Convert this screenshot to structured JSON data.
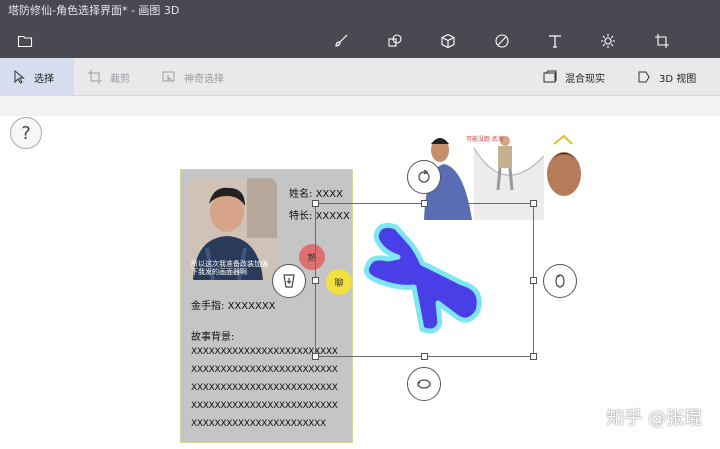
{
  "window": {
    "title": "塔防修仙-角色选择界面* - 画图 3D"
  },
  "toolbar": {
    "tools": [
      {
        "name": "folder-icon"
      },
      {
        "name": "brush-icon"
      },
      {
        "name": "2d-shapes-icon"
      },
      {
        "name": "3d-shapes-icon"
      },
      {
        "name": "stickers-icon"
      },
      {
        "name": "text-icon"
      },
      {
        "name": "effects-icon"
      },
      {
        "name": "canvas-icon"
      }
    ]
  },
  "subbar": {
    "select": "选择",
    "crop": "裁剪",
    "magic_select": "神奇选择",
    "mixed_reality": "混合现实",
    "view3d": "3D 视图"
  },
  "help": {
    "label": "?"
  },
  "card": {
    "name_label": "姓名:",
    "name_value": "XXXX",
    "trait_label": "特长:",
    "trait_value": "XXXXX",
    "cheat_label": "金手指:",
    "cheat_value": "XXXXXXX",
    "story_label": "故事背景:",
    "story_lines": [
      "XXXXXXXXXXXXXXXXXXXXXXXXX",
      "XXXXXXXXXXXXXXXXXXXXXXXXX",
      "XXXXXXXXXXXXXXXXXXXXXXXXX",
      "XXXXXXXXXXXXXXXXXXXXXXXXX",
      "XXXXXXXXXXXXXXXXXXXXXXX"
    ],
    "photo_caption": "所以这次我准备改装加强下我发的画面器啊",
    "bubble_red": "熟",
    "bubble_yellow": "聊"
  },
  "sticker": {
    "caption": "可能没跑 武者"
  },
  "colors": {
    "shape_fill": "#4a3fe6",
    "shape_glow": "#7de6f2",
    "bubble_red": "#e07070",
    "bubble_yellow": "#f0e040"
  },
  "watermark": "知乎 @张琨"
}
